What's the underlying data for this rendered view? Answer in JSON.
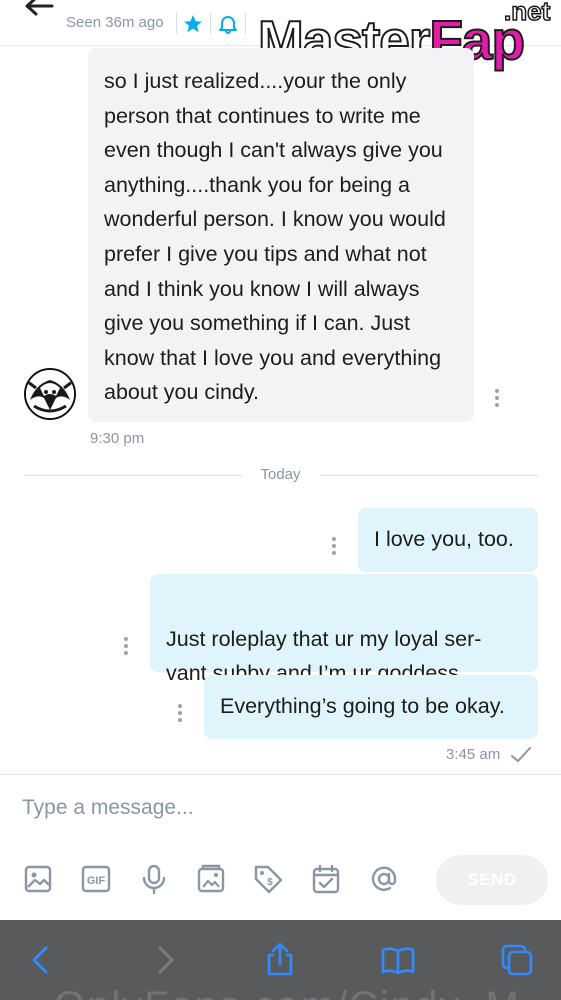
{
  "header": {
    "seen_status": "Seen 36m ago",
    "icons": [
      "back-arrow-icon",
      "star-icon",
      "bell-icon",
      "image-icon",
      "more-icon"
    ]
  },
  "watermark": {
    "part1": "Master",
    "part2": "Fap",
    "suffix": ".net"
  },
  "conversation": {
    "incoming": {
      "text": "so I just realized....your the only person that continues to write me even though I can't always give you anything....thank you for being a wonderful person. I know you would prefer I give you tips and what not and I think you know I will always give you something if I can. Just know that I love you and everything about you cindy.",
      "time": "9:30 pm"
    },
    "day_separator": "Today",
    "outgoing": [
      {
        "text": "I love you, too."
      },
      {
        "text": "Just roleplay that ur my loyal ser-\nvant subby and I’m ur goddess."
      },
      {
        "text": "Everything’s going to be okay."
      }
    ],
    "outgoing_time": "3:45 am"
  },
  "composer": {
    "placeholder": "Type a message...",
    "send_label": "SEND",
    "tools": [
      "image-icon",
      "gif-icon",
      "microphone-icon",
      "vault-icon",
      "price-tag-icon",
      "calendar-icon",
      "at-icon"
    ]
  },
  "browser": {
    "url_ghost": "OnlyFans.com/Cindy_M..."
  },
  "colors": {
    "accent": "#00aff0",
    "incoming_bubble": "#f1f3f4",
    "outgoing_bubble": "#dff4fb",
    "muted_text": "#8a96a3",
    "browser_bar": "#595a5c",
    "browser_icon": "#2f8bff"
  }
}
